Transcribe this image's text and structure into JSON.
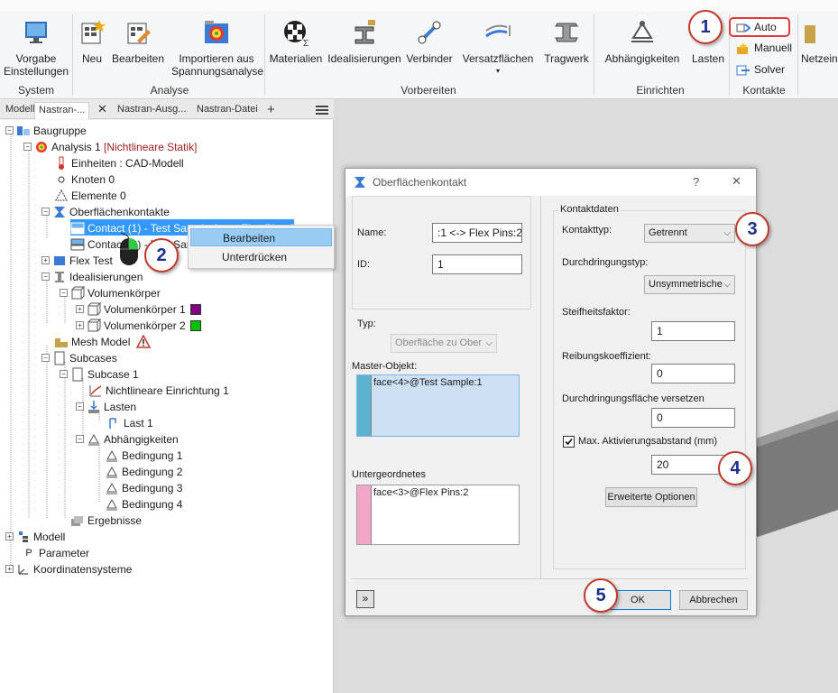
{
  "ribbon": {
    "system_group": "System",
    "analyse_group": "Analyse",
    "vorbereiten_group": "Vorbereiten",
    "einrichten_group": "Einrichten",
    "kontakte_group": "Kontakte",
    "vorgabe_line1": "Vorgabe",
    "vorgabe_line2": "Einstellungen",
    "neu": "Neu",
    "bearbeiten": "Bearbeiten",
    "importieren_line1": "Importieren aus",
    "importieren_line2": "Spannungsanalyse",
    "materialien": "Materialien",
    "idealisierungen": "Idealisierungen",
    "verbinder": "Verbinder",
    "versatzflaechen": "Versatzflächen",
    "tragwerk": "Tragwerk",
    "abhaengigkeiten": "Abhängigkeiten",
    "lasten": "Lasten",
    "auto": "Auto",
    "manuell": "Manuell",
    "solver": "Solver",
    "netzeinst": "Netzein"
  },
  "browser": {
    "tabs": [
      "Modell",
      "Nastran-...",
      "Nastran-Ausg...",
      "Nastran-Datei"
    ],
    "add_tab": "+",
    "menu_icon": "hamburger-icon",
    "tree": {
      "baugruppe": "Baugruppe",
      "analysis_name": "Analysis 1",
      "analysis_type": "[Nichtlineare Statik]",
      "einheiten": "Einheiten : CAD-Modell",
      "knoten": "Knoten 0",
      "elemente": "Elemente 0",
      "oberflaechenkontakte": "Oberflächenkontakte",
      "contact1": "Contact (1) - Test Sample:1 <-> Flex Pins:2",
      "contact2": "Contact (2) - Test Sample:1",
      "flex_test": "Flex Test",
      "idealisierungen": "Idealisierungen",
      "volumenkoerper": "Volumenkörper",
      "volumenkoerper1": "Volumenkörper 1",
      "volumenkoerper2": "Volumenkörper 2",
      "vk1_color": "#800080",
      "vk2_color": "#00c000",
      "mesh_model": "Mesh Model",
      "subcases": "Subcases",
      "subcase1": "Subcase 1",
      "nichtlineare": "Nichtlineare Einrichtung 1",
      "lasten": "Lasten",
      "last1": "Last 1",
      "abhaengigkeiten": "Abhängigkeiten",
      "bedingung1": "Bedingung 1",
      "bedingung2": "Bedingung 2",
      "bedingung3": "Bedingung 3",
      "bedingung4": "Bedingung 4",
      "ergebnisse": "Ergebnisse",
      "modell": "Modell",
      "parameter": "Parameter",
      "koordinatensysteme": "Koordinatensysteme"
    }
  },
  "context_menu": {
    "bearbeiten": "Bearbeiten",
    "unterdruecken": "Unterdrücken"
  },
  "dialog": {
    "title": "Oberflächenkontakt",
    "help": "?",
    "close": "✕",
    "name_label": "Name:",
    "name_value": ":1 <-> Flex Pins:2",
    "id_label": "ID:",
    "id_value": "1",
    "typ_label": "Typ:",
    "typ_value": "Oberfläche zu Ober",
    "master_label": "Master-Objekt:",
    "master_value": "face<4>@Test Sample:1",
    "master_color": "#5bb3d0",
    "untergeordnetes_label": "Untergeordnetes",
    "untergeordnetes_value": "face<3>@Flex Pins:2",
    "untergeordnetes_color": "#f3a7c8",
    "kontaktdaten": "Kontaktdaten",
    "kontakttyp_label": "Kontakttyp:",
    "kontakttyp_value": "Getrennt",
    "durchdringungstyp_label": "Durchdringungstyp:",
    "durchdringungstyp_value": "Unsymmetrische",
    "steifheitsfaktor_label": "Steifheitsfaktor:",
    "steifheitsfaktor_value": "1",
    "reibung_label": "Reibungskoeffizient:",
    "reibung_value": "0",
    "versetzen_label": "Durchdringungsfläche versetzen",
    "versetzen_value": "0",
    "max_akt_label": "Max. Aktivierungsabstand (mm)",
    "max_akt_checked": true,
    "max_akt_value": "20",
    "erweiterte": "Erweiterte Optionen",
    "ok": "OK",
    "abbrechen": "Abbrechen",
    "expand": "»"
  },
  "callouts": [
    "1",
    "2",
    "3",
    "4",
    "5"
  ],
  "colors": {
    "accent_red": "#c0392b",
    "callout_text": "#1a2f8a",
    "selection": "#3399ff"
  }
}
